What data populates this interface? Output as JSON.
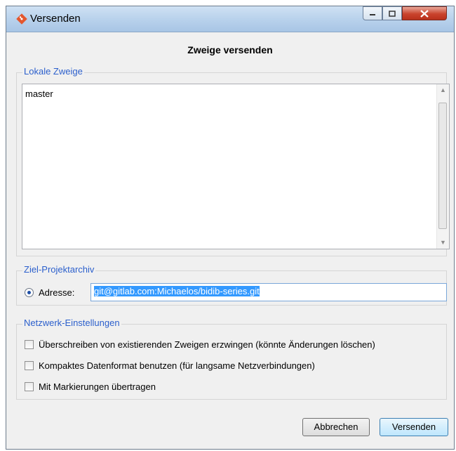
{
  "window": {
    "title": "Versenden"
  },
  "heading": "Zweige versenden",
  "local_branches": {
    "legend": "Lokale Zweige",
    "items": [
      "master"
    ]
  },
  "target": {
    "legend": "Ziel-Projektarchiv",
    "radio_label": "Adresse:",
    "address_value": "git@gitlab.com:Michaelos/bidib-series.git"
  },
  "network": {
    "legend": "Netzwerk-Einstellungen",
    "options": [
      {
        "label": "Überschreiben von existierenden Zweigen erzwingen (könnte Änderungen löschen)",
        "checked": false
      },
      {
        "label": "Kompaktes Datenformat benutzen (für langsame Netzverbindungen)",
        "checked": false
      },
      {
        "label": "Mit Markierungen übertragen",
        "checked": false
      }
    ]
  },
  "buttons": {
    "cancel": "Abbrechen",
    "send": "Versenden"
  },
  "colors": {
    "legend": "#2b5fcc",
    "selection": "#3399ff"
  },
  "icons": [
    "git-app-icon",
    "minimize-icon",
    "maximize-icon",
    "close-icon",
    "scroll-up-icon",
    "scroll-down-icon"
  ]
}
